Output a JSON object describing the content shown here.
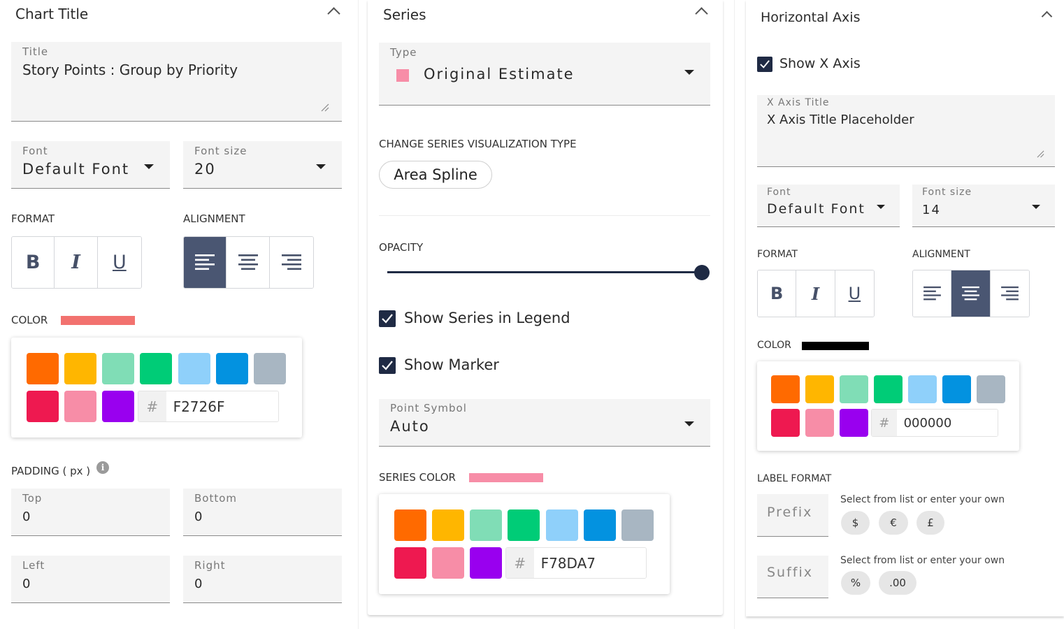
{
  "chart_title": {
    "header": "Chart Title",
    "title_field": {
      "label": "Title",
      "value": "Story Points : Group by Priority"
    },
    "font": {
      "label": "Font",
      "value": "Default Font"
    },
    "font_size": {
      "label": "Font size",
      "value": "20"
    },
    "format_label": "FORMAT",
    "alignment_label": "ALIGNMENT",
    "format_buttons": [
      "B",
      "I",
      "U"
    ],
    "active_alignment": "left",
    "color_label": "COLOR",
    "color_value": "#F2726F",
    "palette": [
      "#FF6A00",
      "#FFB600",
      "#80DDB6",
      "#00CC77",
      "#8FD0FA",
      "#0392E0",
      "#A8B6C2",
      "#EE1950",
      "#F78DA7",
      "#9900EF"
    ],
    "hex_symbol": "#",
    "hex_value": "F2726F",
    "padding_label": "PADDING ( px )",
    "padding_info_icon": "i",
    "padding": {
      "top": {
        "label": "Top",
        "value": "0"
      },
      "bottom": {
        "label": "Bottom",
        "value": "0"
      },
      "left": {
        "label": "Left",
        "value": "0"
      },
      "right": {
        "label": "Right",
        "value": "0"
      }
    }
  },
  "series": {
    "header": "Series",
    "type": {
      "label": "Type",
      "value": "Original Estimate",
      "swatch_color": "#F78DA7"
    },
    "change_type_label": "CHANGE SERIES VISUALIZATION TYPE",
    "viz_type": "Area Spline",
    "opacity_label": "OPACITY",
    "opacity_value": 1.0,
    "show_in_legend": {
      "label": "Show Series in Legend",
      "checked": true
    },
    "show_marker": {
      "label": "Show Marker",
      "checked": true
    },
    "point_symbol": {
      "label": "Point Symbol",
      "value": "Auto"
    },
    "series_color_label": "SERIES COLOR",
    "series_color_value": "#F78DA7",
    "palette": [
      "#FF6A00",
      "#FFB600",
      "#80DDB6",
      "#00CC77",
      "#8FD0FA",
      "#0392E0",
      "#A8B6C2",
      "#EE1950",
      "#F78DA7",
      "#9900EF"
    ],
    "hex_symbol": "#",
    "hex_value": "F78DA7"
  },
  "horizontal_axis": {
    "header": "Horizontal Axis",
    "show_x_axis": {
      "label": "Show X Axis",
      "checked": true
    },
    "axis_title": {
      "label": "X Axis Title",
      "value": "X Axis Title Placeholder"
    },
    "font": {
      "label": "Font",
      "value": "Default Font"
    },
    "font_size": {
      "label": "Font size",
      "value": "14"
    },
    "format_label": "FORMAT",
    "alignment_label": "ALIGNMENT",
    "format_buttons": [
      "B",
      "I",
      "U"
    ],
    "active_alignment": "center",
    "color_label": "COLOR",
    "color_value": "#000000",
    "palette": [
      "#FF6A00",
      "#FFB600",
      "#80DDB6",
      "#00CC77",
      "#8FD0FA",
      "#0392E0",
      "#A8B6C2",
      "#EE1950",
      "#F78DA7",
      "#9900EF"
    ],
    "hex_symbol": "#",
    "hex_value": "000000",
    "label_format_label": "LABEL FORMAT",
    "prefix": {
      "placeholder": "Prefix",
      "hint": "Select from list or enter your own",
      "options": [
        "$",
        "€",
        "£"
      ]
    },
    "suffix": {
      "placeholder": "Suffix",
      "hint": "Select from list or enter your own",
      "options": [
        "%",
        ".00"
      ]
    }
  }
}
